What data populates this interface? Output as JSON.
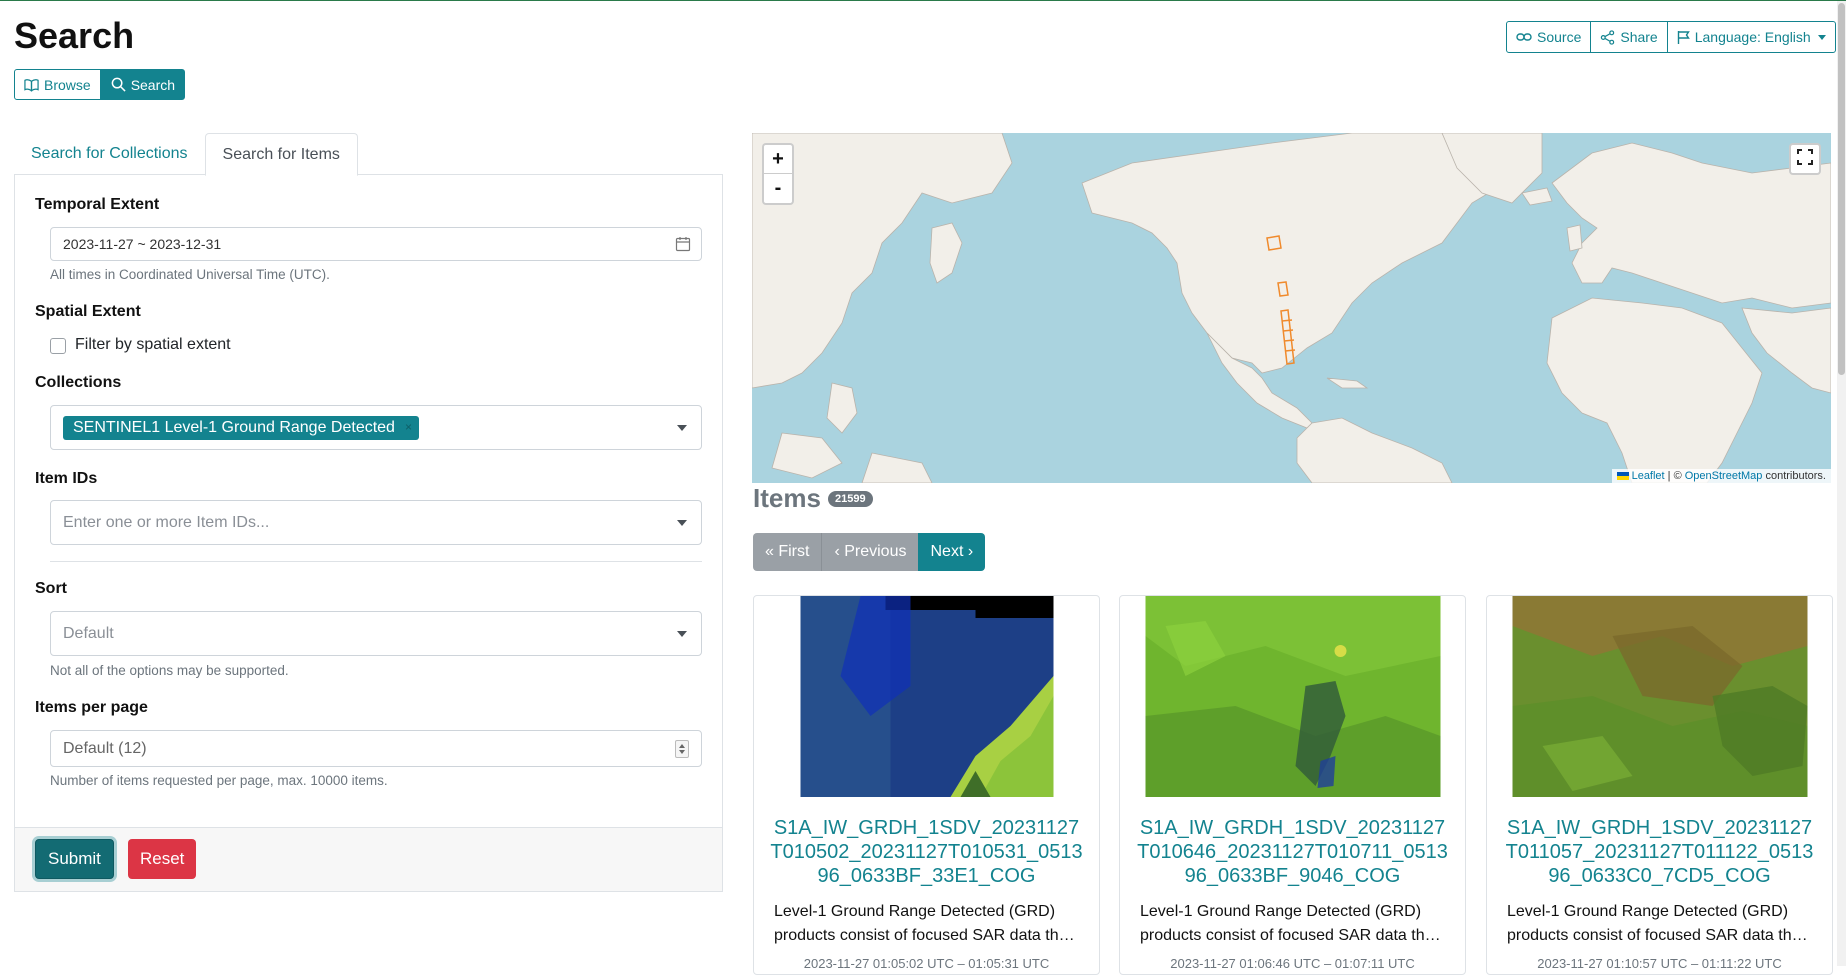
{
  "page": {
    "title": "Search"
  },
  "view_switch": {
    "browse": "Browse",
    "search": "Search"
  },
  "top_actions": {
    "source": "Source",
    "share": "Share",
    "language": "Language: English"
  },
  "tabs": {
    "collections": "Search for Collections",
    "items": "Search for Items"
  },
  "form": {
    "temporal_label": "Temporal Extent",
    "temporal_value": "2023-11-27 ~ 2023-12-31",
    "temporal_hint": "All times in Coordinated Universal Time (UTC).",
    "spatial_label": "Spatial Extent",
    "spatial_checkbox": "Filter by spatial extent",
    "collections_label": "Collections",
    "collections_selected": "SENTINEL1 Level-1 Ground Range Detected",
    "item_ids_label": "Item IDs",
    "item_ids_placeholder": "Enter one or more Item IDs...",
    "sort_label": "Sort",
    "sort_value": "Default",
    "sort_hint": "Not all of the options may be supported.",
    "per_page_label": "Items per page",
    "per_page_value": "Default (12)",
    "per_page_hint": "Number of items requested per page, max. 10000 items.",
    "submit": "Submit",
    "reset": "Reset"
  },
  "map": {
    "zoom_in": "+",
    "zoom_out": "-",
    "attribution_leaflet": "Leaflet",
    "attribution_sep": " | © ",
    "attribution_osm": "OpenStreetMap",
    "attribution_tail": " contributors.",
    "colors": {
      "water": "#aad3df",
      "land": "#f2efe9",
      "footprint": "#f08a2c"
    }
  },
  "items": {
    "title": "Items",
    "count": "21599",
    "pager": {
      "first": "« First",
      "previous": "‹ Previous",
      "next": "Next ›"
    },
    "cards": [
      {
        "title_lines": [
          "S1A_IW_GRDH_1SDV_20231127",
          "T010502_20231127T010531_0513",
          "96_0633BF_33E1_COG"
        ],
        "desc_lines": [
          "Level-1 Ground Range Detected (GRD)",
          "products consist of focused SAR data th…"
        ],
        "time": "2023-11-27 01:05:02 UTC – 01:05:31 UTC"
      },
      {
        "title_lines": [
          "S1A_IW_GRDH_1SDV_20231127",
          "T010646_20231127T010711_0513",
          "96_0633BF_9046_COG"
        ],
        "desc_lines": [
          "Level-1 Ground Range Detected (GRD)",
          "products consist of focused SAR data th…"
        ],
        "time": "2023-11-27 01:06:46 UTC – 01:07:11 UTC"
      },
      {
        "title_lines": [
          "S1A_IW_GRDH_1SDV_20231127",
          "T011057_20231127T011122_0513",
          "96_0633C0_7CD5_COG"
        ],
        "desc_lines": [
          "Level-1 Ground Range Detected (GRD)",
          "products consist of focused SAR data th…"
        ],
        "time": "2023-11-27 01:10:57 UTC – 01:11:22 UTC"
      }
    ]
  }
}
